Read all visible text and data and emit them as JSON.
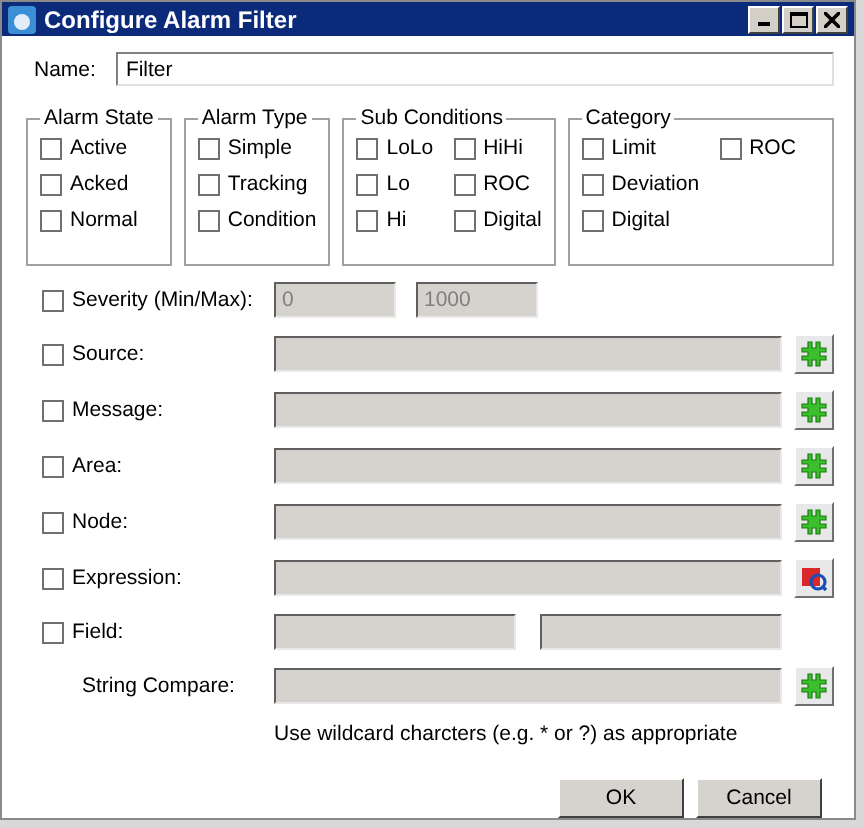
{
  "window": {
    "title": "Configure Alarm Filter"
  },
  "name": {
    "label": "Name:",
    "value": "Filter"
  },
  "groups": [
    {
      "title": "Alarm State",
      "columns": [
        [
          {
            "label": "Active",
            "checked": false
          },
          {
            "label": "Acked",
            "checked": false
          },
          {
            "label": "Normal",
            "checked": false
          }
        ]
      ]
    },
    {
      "title": "Alarm Type",
      "columns": [
        [
          {
            "label": "Simple",
            "checked": false
          },
          {
            "label": "Tracking",
            "checked": false
          },
          {
            "label": "Condition",
            "checked": false
          }
        ]
      ]
    },
    {
      "title": "Sub Conditions",
      "columns": [
        [
          {
            "label": "LoLo",
            "checked": false
          },
          {
            "label": "Lo",
            "checked": false
          },
          {
            "label": "Hi",
            "checked": false
          }
        ],
        [
          {
            "label": "HiHi",
            "checked": false
          },
          {
            "label": "ROC",
            "checked": false
          },
          {
            "label": "Digital",
            "checked": false
          }
        ]
      ]
    },
    {
      "title": "Category",
      "columns": [
        [
          {
            "label": "Limit",
            "checked": false
          },
          {
            "label": "Deviation",
            "checked": false
          },
          {
            "label": "Digital",
            "checked": false
          }
        ],
        [
          {
            "label": "ROC",
            "checked": false
          }
        ]
      ]
    }
  ],
  "filters": [
    {
      "kind": "range",
      "label": "Severity (Min/Max):",
      "checked": false,
      "values": [
        "0",
        "1000"
      ]
    },
    {
      "kind": "browse",
      "label": "Source:",
      "checked": false
    },
    {
      "kind": "browse",
      "label": "Message:",
      "checked": false
    },
    {
      "kind": "browse",
      "label": "Area:",
      "checked": false
    },
    {
      "kind": "browse",
      "label": "Node:",
      "checked": false
    },
    {
      "kind": "expression",
      "label": "Expression:",
      "checked": false
    },
    {
      "kind": "pair",
      "label": "Field:",
      "checked": false
    }
  ],
  "string_compare": {
    "label": "String Compare:"
  },
  "hint": "Use wildcard charcters (e.g. * or ?) as appropriate",
  "buttons": [
    "OK",
    "Cancel"
  ]
}
